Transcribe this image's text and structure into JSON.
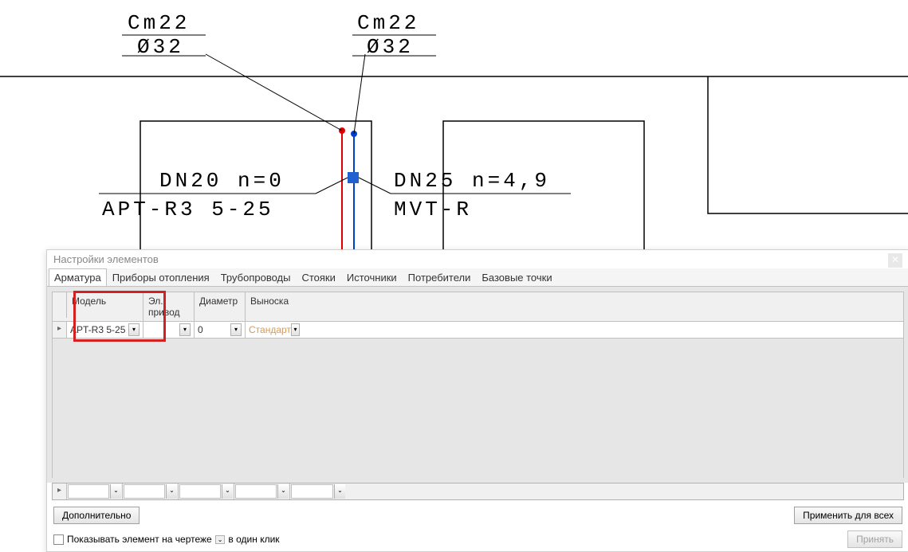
{
  "cad_labels": {
    "label1_line1": "Cm22",
    "label1_line2": "Ø32",
    "label2_line1": "Cm22",
    "label2_line2": "Ø32",
    "label3_line1": "DN20 n=0",
    "label3_line2": "APT-R3 5-25",
    "label4_line1": "DN25 n=4,9",
    "label4_line2": "MVT-R"
  },
  "dialog": {
    "title": "Настройки элементов",
    "tabs": [
      "Арматура",
      "Приборы отопления",
      "Трубопроводы",
      "Стояки",
      "Источники",
      "Потребители",
      "Базовые точки"
    ],
    "headers": {
      "model": "Модель",
      "drive": "Эл. привод",
      "diameter": "Диаметр",
      "callout": "Выноска"
    },
    "row": {
      "model": "APT-R3 5-25",
      "drive": "",
      "diameter": "0",
      "callout": "Стандарт"
    },
    "buttons": {
      "more": "Дополнительно",
      "apply_all": "Применить для всех",
      "accept": "Принять"
    },
    "checkbox_label": "Показывать элемент на чертеже",
    "one_click": "в один клик"
  }
}
